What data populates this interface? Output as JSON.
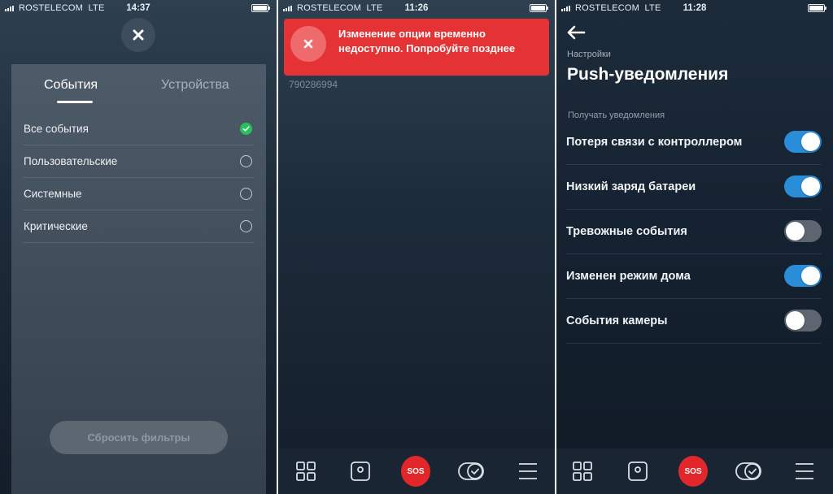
{
  "screens": [
    {
      "status": {
        "carrier": "ROSTELECOM",
        "network": "LTE",
        "time": "14:37"
      },
      "filter": {
        "tabs": [
          {
            "label": "События"
          },
          {
            "label": "Устройства"
          }
        ],
        "options": [
          {
            "label": "Все события",
            "selected": true
          },
          {
            "label": "Пользовательские",
            "selected": false
          },
          {
            "label": "Системные",
            "selected": false
          },
          {
            "label": "Критические",
            "selected": false
          }
        ],
        "reset_label": "Сбросить фильтры"
      }
    },
    {
      "status": {
        "carrier": "ROSTELECOM",
        "network": "LTE",
        "time": "11:26"
      },
      "toast": {
        "message": "Изменение опции временно недоступно. Попробуйте позднее",
        "color": "#e53235"
      },
      "account_number": "790286994",
      "nav": {
        "sos_label": "SOS"
      }
    },
    {
      "status": {
        "carrier": "ROSTELECOM",
        "network": "LTE",
        "time": "11:28"
      },
      "settings": {
        "breadcrumb": "Настройки",
        "title": "Push-уведомления",
        "section_label": "Получать уведомления",
        "items": [
          {
            "label": "Потеря связи с контроллером",
            "enabled": true
          },
          {
            "label": "Низкий заряд батареи",
            "enabled": true
          },
          {
            "label": "Тревожные события",
            "enabled": false
          },
          {
            "label": "Изменен режим дома",
            "enabled": true
          },
          {
            "label": "События камеры",
            "enabled": false
          }
        ]
      },
      "nav": {
        "sos_label": "SOS"
      }
    }
  ],
  "colors": {
    "accent_blue": "#2a8dd8",
    "success_green": "#27c15c",
    "sos_red": "#e2272a"
  }
}
